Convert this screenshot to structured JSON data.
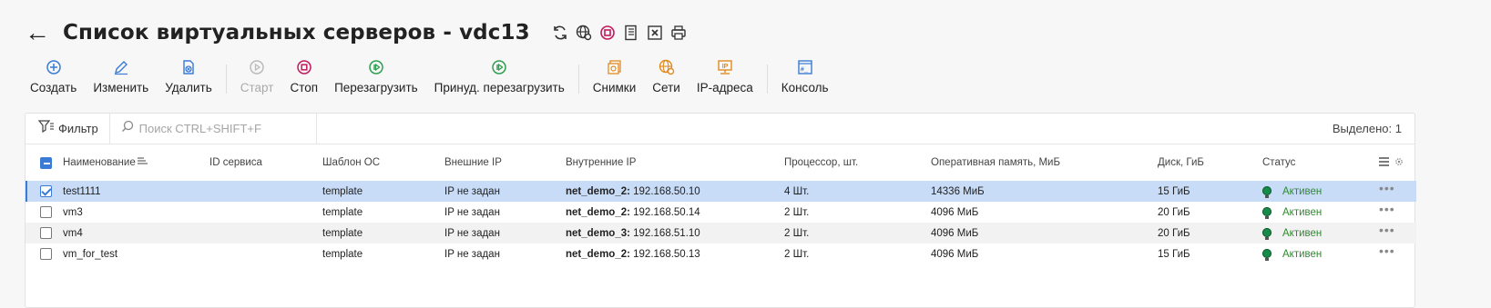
{
  "header": {
    "title": "Список виртуальных серверов - vdc13"
  },
  "toolbar": {
    "create": "Создать",
    "edit": "Изменить",
    "delete": "Удалить",
    "start": "Старт",
    "stop": "Стоп",
    "restart": "Перезагрузить",
    "force_restart": "Принуд. перезагрузить",
    "snapshots": "Снимки",
    "networks": "Сети",
    "ip_addresses": "IP-адреса",
    "console": "Консоль"
  },
  "filterbar": {
    "filter_label": "Фильтр",
    "search_placeholder": "Поиск CTRL+SHIFT+F",
    "selected_label": "Выделено:",
    "selected_count": "1"
  },
  "table": {
    "columns": {
      "name": "Наименование",
      "service_id": "ID сервиса",
      "os_template": "Шаблон ОС",
      "external_ip": "Внешние IP",
      "internal_ip": "Внутренние IP",
      "cpu": "Процессор, шт.",
      "ram": "Оперативная память, МиБ",
      "disk": "Диск, ГиБ",
      "status": "Статус"
    },
    "rows": [
      {
        "name": "test1111",
        "service_id": "",
        "template": "template",
        "external_ip": "IP не задан",
        "net_name": "net_demo_2:",
        "net_ip": "192.168.50.10",
        "cpu": "4 Шт.",
        "ram": "14336 МиБ",
        "disk": "15 ГиБ",
        "status": "Активен",
        "checked": true
      },
      {
        "name": "vm3",
        "service_id": "",
        "template": "template",
        "external_ip": "IP не задан",
        "net_name": "net_demo_2:",
        "net_ip": "192.168.50.14",
        "cpu": "2 Шт.",
        "ram": "4096 МиБ",
        "disk": "20 ГиБ",
        "status": "Активен",
        "checked": false
      },
      {
        "name": "vm4",
        "service_id": "",
        "template": "template",
        "external_ip": "IP не задан",
        "net_name": "net_demo_3:",
        "net_ip": "192.168.51.10",
        "cpu": "2 Шт.",
        "ram": "4096 МиБ",
        "disk": "20 ГиБ",
        "status": "Активен",
        "checked": false
      },
      {
        "name": "vm_for_test",
        "service_id": "",
        "template": "template",
        "external_ip": "IP не задан",
        "net_name": "net_demo_2:",
        "net_ip": "192.168.50.13",
        "cpu": "2 Шт.",
        "ram": "4096 МиБ",
        "disk": "15 ГиБ",
        "status": "Активен",
        "checked": false
      }
    ]
  },
  "colors": {
    "accent_blue": "#3a7bd5",
    "stop_pink": "#c2185b",
    "restart_green": "#2e9e4f",
    "orange": "#e08a1e",
    "status_green": "#2e8b2e"
  }
}
